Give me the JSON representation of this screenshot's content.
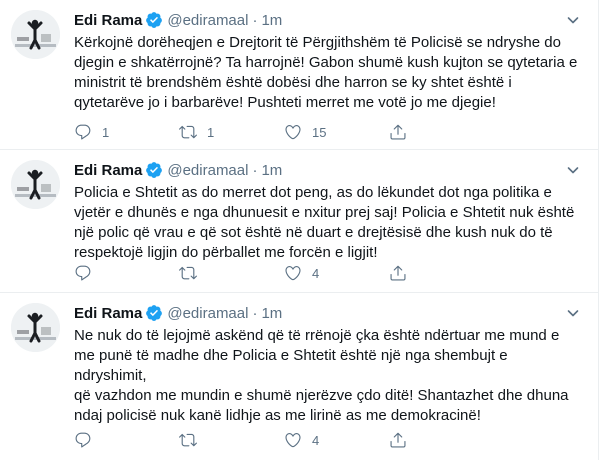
{
  "tweets": [
    {
      "author": {
        "name": "Edi Rama",
        "handle": "@ediramaal"
      },
      "separator": "·",
      "time": "1m",
      "lines": [
        "Kërkojnë dorëheqjen e Drejtorit të Përgjithshëm të Policisë se ndryshe do",
        "djegin e shkatërrojnë? Ta harrojnë! Gabon shumë kush kujton se qytetaria e",
        "ministrit të brendshëm është dobësi dhe harron se ky shtet është i",
        "qytetarëve jo i barbarëve! Pushteti merret me votë jo me djegie!"
      ],
      "counts": {
        "reply": "1",
        "retweet": "1",
        "like": "15"
      }
    },
    {
      "author": {
        "name": "Edi Rama",
        "handle": "@ediramaal"
      },
      "separator": "·",
      "time": "1m",
      "lines": [
        "Policia e Shtetit as do merret dot peng, as do lëkundet dot nga politika e",
        "vjetër e dhunës e nga dhunuesit e nxitur prej saj! Policia e Shtetit nuk është",
        "një polic që vrau e që sot është në duart e drejtësisë dhe kush nuk do të",
        "respektojë ligjin do përballet me forcën e ligjit!"
      ],
      "counts": {
        "reply": "",
        "retweet": "",
        "like": "4"
      }
    },
    {
      "author": {
        "name": "Edi Rama",
        "handle": "@ediramaal"
      },
      "separator": "·",
      "time": "1m",
      "lines": [
        "Ne nuk do të lejojmë askënd që të rrënojë çka është ndërtuar me mund e",
        "me punë të madhe dhe Policia e Shtetit është një nga shembujt e ndryshimit,",
        "që vazhdon me mundin e shumë njerëzve çdo ditë! Shantazhet dhe dhuna",
        "ndaj policisë nuk kanë lidhje as me lirinë as me demokracinë!"
      ],
      "counts": {
        "reply": "",
        "retweet": "",
        "like": "4"
      }
    }
  ],
  "icons": {
    "verified": "verified-badge-icon",
    "more": "chevron-down-icon",
    "reply": "reply-icon",
    "retweet": "retweet-icon",
    "like": "heart-icon",
    "share": "share-icon"
  },
  "colors": {
    "text": "#0f1419",
    "secondary": "#5b7083",
    "verified": "#1da1f2",
    "divider": "#ebeef0"
  }
}
